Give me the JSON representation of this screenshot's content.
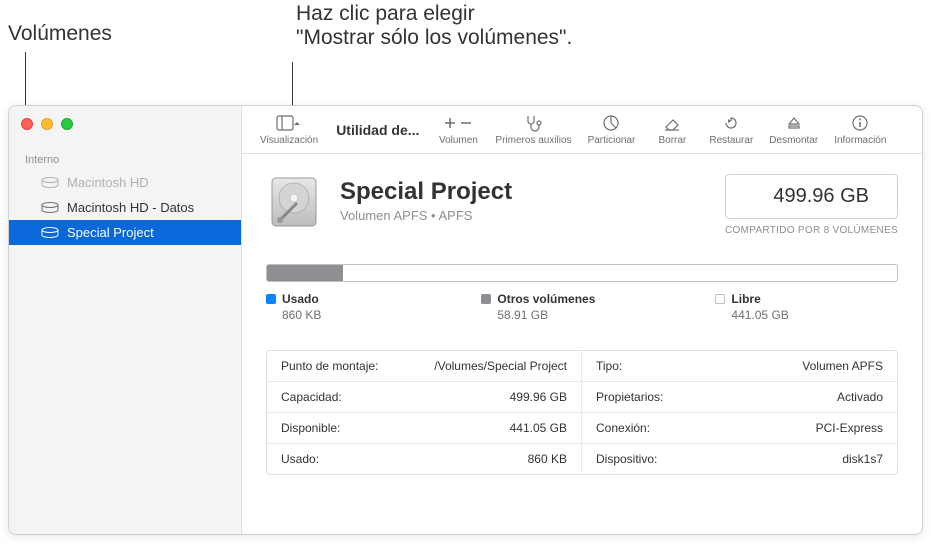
{
  "callouts": {
    "volumes": "Volúmenes",
    "view_hint_l1": "Haz clic para elegir",
    "view_hint_l2": "\"Mostrar sólo los volúmenes\"."
  },
  "sidebar": {
    "section": "Interno",
    "items": [
      {
        "label": "Macintosh HD",
        "dim": true
      },
      {
        "label": "Macintosh HD - Datos",
        "dim": false
      },
      {
        "label": "Special Project",
        "dim": false
      }
    ]
  },
  "toolbar": {
    "title": "Utilidad de...",
    "view": "Visualización",
    "volume": "Volumen",
    "first_aid": "Primeros auxilios",
    "partition": "Particionar",
    "erase": "Borrar",
    "restore": "Restaurar",
    "unmount": "Desmontar",
    "info": "Información"
  },
  "volume": {
    "name": "Special Project",
    "subtitle": "Volumen APFS  •  APFS",
    "capacity_display": "499.96 GB",
    "shared_note": "COMPARTIDO POR 8 VOLÚMENES"
  },
  "usage": {
    "used_label": "Usado",
    "used_value": "860 KB",
    "other_label": "Otros volúmenes",
    "other_value": "58.91 GB",
    "free_label": "Libre",
    "free_value": "441.05 GB"
  },
  "info": {
    "mount_point_k": "Punto de montaje:",
    "mount_point_v": "/Volumes/Special Project",
    "type_k": "Tipo:",
    "type_v": "Volumen APFS",
    "capacity_k": "Capacidad:",
    "capacity_v": "499.96 GB",
    "owners_k": "Propietarios:",
    "owners_v": "Activado",
    "available_k": "Disponible:",
    "available_v": "441.05 GB",
    "connection_k": "Conexión:",
    "connection_v": "PCI-Express",
    "used_k": "Usado:",
    "used_v": "860 KB",
    "device_k": "Dispositivo:",
    "device_v": "disk1s7"
  }
}
